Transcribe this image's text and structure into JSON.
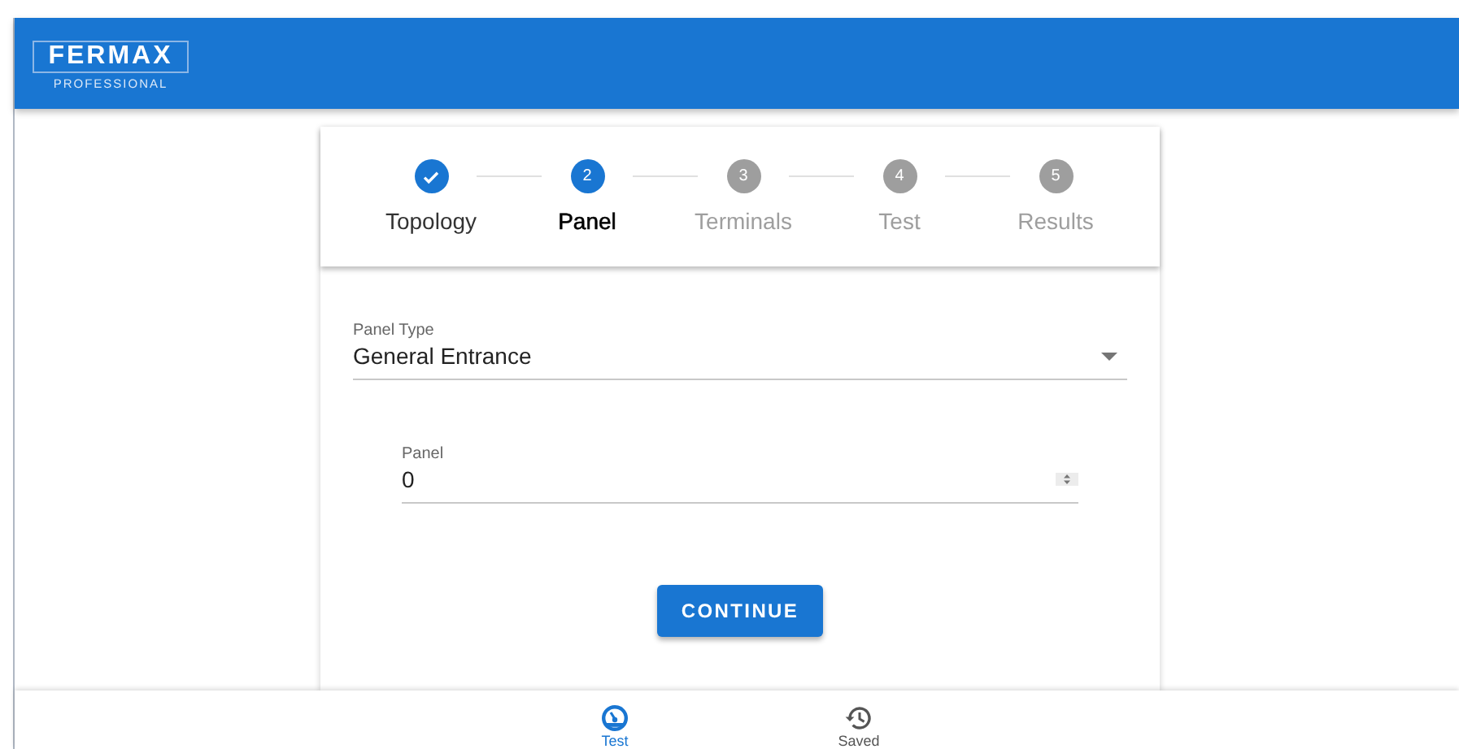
{
  "header": {
    "logo": "FERMAX",
    "subtitle": "PROFESSIONAL"
  },
  "steps": [
    {
      "label": "Topology",
      "completed": true,
      "selected": false
    },
    {
      "number": "2",
      "label": "Panel",
      "completed": false,
      "selected": true
    },
    {
      "number": "3",
      "label": "Terminals",
      "completed": false,
      "selected": false
    },
    {
      "number": "4",
      "label": "Test",
      "completed": false,
      "selected": false
    },
    {
      "number": "5",
      "label": "Results",
      "completed": false,
      "selected": false
    }
  ],
  "form": {
    "panel_type": {
      "label": "Panel Type",
      "value": "General Entrance"
    },
    "panel": {
      "label": "Panel",
      "value": "0"
    },
    "button": "CONTINUE"
  },
  "bottom_nav": [
    {
      "label": "Test",
      "kind": "gauge",
      "selected": true
    },
    {
      "label": "Saved",
      "kind": "history",
      "selected": false
    }
  ]
}
